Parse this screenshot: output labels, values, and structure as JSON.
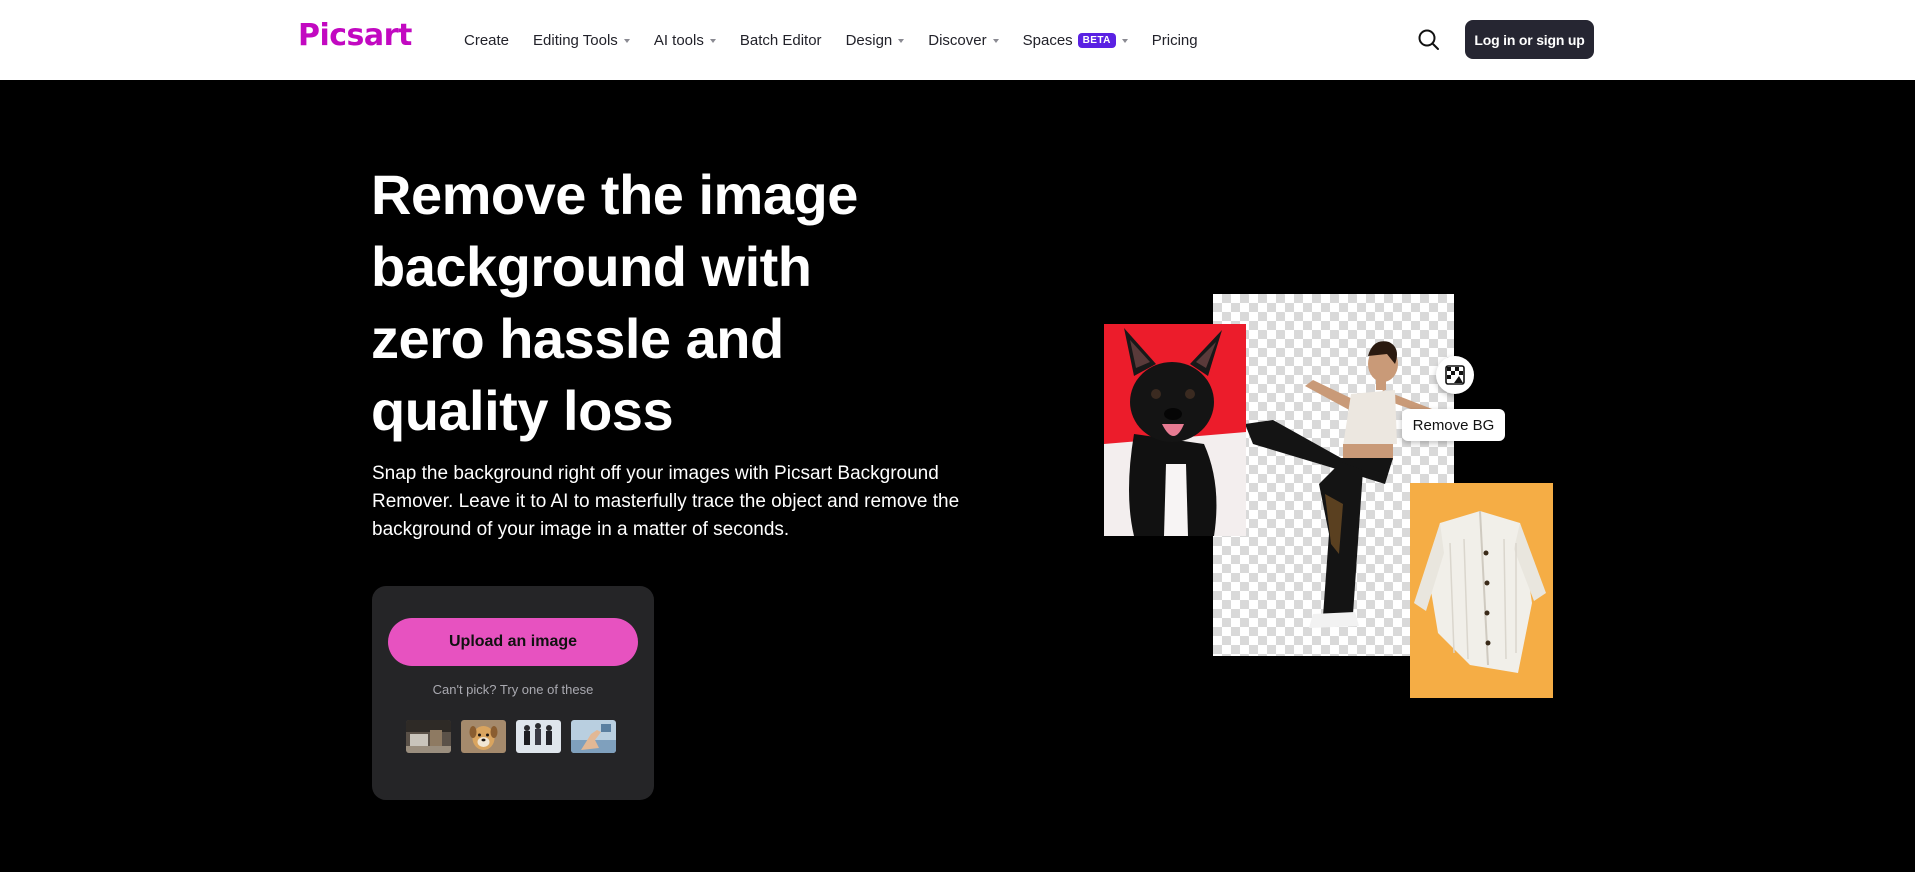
{
  "header": {
    "logo": "Picsart",
    "nav": [
      {
        "label": "Create",
        "dropdown": false
      },
      {
        "label": "Editing Tools",
        "dropdown": true
      },
      {
        "label": "AI tools",
        "dropdown": true
      },
      {
        "label": "Batch Editor",
        "dropdown": false
      },
      {
        "label": "Design",
        "dropdown": true
      },
      {
        "label": "Discover",
        "dropdown": true
      },
      {
        "label": "Spaces",
        "badge": "BETA",
        "dropdown": true
      },
      {
        "label": "Pricing",
        "dropdown": false
      }
    ],
    "search_icon": "search-icon",
    "login_label": "Log in or sign up"
  },
  "hero": {
    "title": "Remove the image background with zero hassle and quality loss",
    "description": "Snap the background right off your images with Picsart Background Remover. Leave it to AI to masterfully trace the object and remove the background of your image in a matter of seconds.",
    "upload_label": "Upload an image",
    "samples_label": "Can't pick? Try one of these",
    "samples": [
      "sample-desk",
      "sample-dog",
      "sample-people",
      "sample-hand"
    ]
  },
  "collage": {
    "remove_bg_label": "Remove BG",
    "remove_bg_icon": "remove-bg-icon"
  },
  "colors": {
    "brand": "#c209c1",
    "upload_button": "#e752c0",
    "beta_badge": "#5a21e3",
    "login_button": "#262632",
    "page_background": "#000000"
  }
}
